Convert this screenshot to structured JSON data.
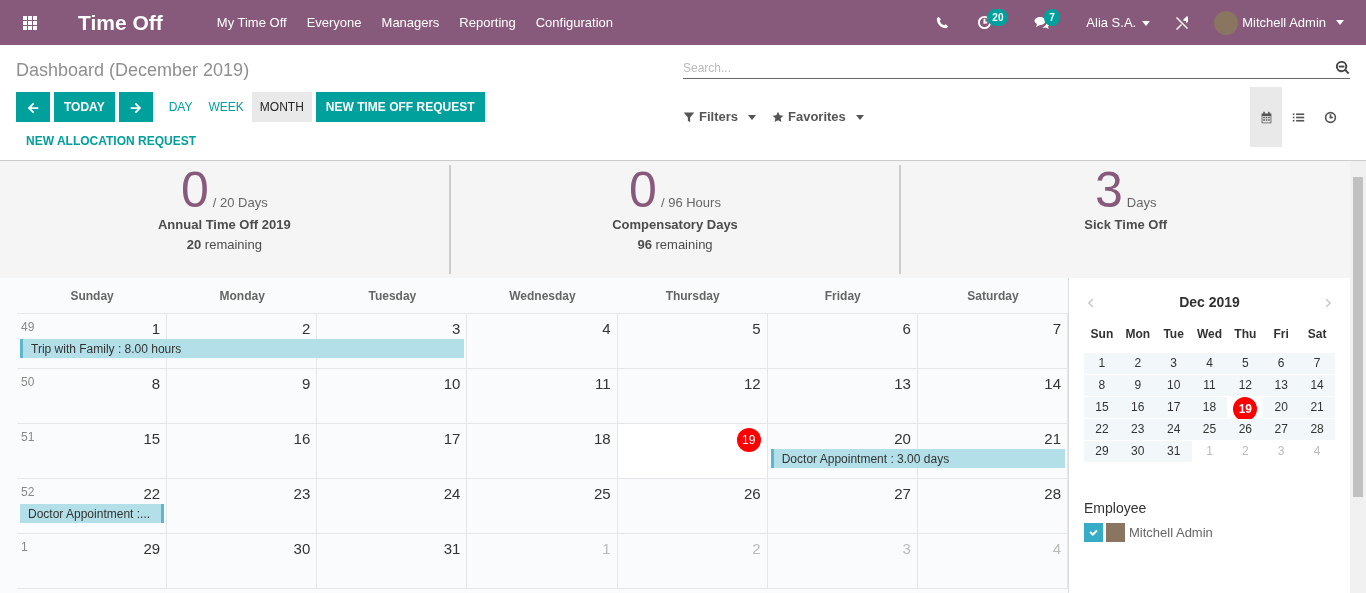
{
  "app": {
    "title": "Time Off"
  },
  "menu": [
    {
      "label": "My Time Off"
    },
    {
      "label": "Everyone"
    },
    {
      "label": "Managers"
    },
    {
      "label": "Reporting"
    },
    {
      "label": "Configuration"
    }
  ],
  "systray": {
    "activity_count": "20",
    "message_count": "7",
    "company": "Alia S.A.",
    "user": "Mitchell Admin"
  },
  "breadcrumb": "Dashboard (December 2019)",
  "today_button": "TODAY",
  "scales": [
    {
      "label": "DAY",
      "selected": false
    },
    {
      "label": "WEEK",
      "selected": false
    },
    {
      "label": "MONTH",
      "selected": true
    }
  ],
  "actions": [
    {
      "label": "NEW TIME OFF REQUEST",
      "kind": "primary"
    },
    {
      "label": "NEW ALLOCATION REQUEST",
      "kind": "link"
    }
  ],
  "search": {
    "placeholder": "Search..."
  },
  "filters": [
    {
      "label": "Filters",
      "kind": "filter"
    },
    {
      "label": "Favorites",
      "kind": "star"
    }
  ],
  "views": [
    {
      "kind": "calendar",
      "selected": true
    },
    {
      "kind": "list",
      "selected": false
    },
    {
      "kind": "activity",
      "selected": false
    }
  ],
  "summary": [
    {
      "value": "0",
      "unit": "/ 20 Days",
      "name": "Annual Time Off 2019",
      "remaining": "**20** remaining"
    },
    {
      "value": "0",
      "unit": "/ 96 Hours",
      "name": "Compensatory Days",
      "remaining": "**96** remaining"
    },
    {
      "value": "3",
      "unit": "Days",
      "name": "Sick Time Off"
    }
  ],
  "calendar": {
    "weekdays": [
      "Sunday",
      "Monday",
      "Tuesday",
      "Wednesday",
      "Thursday",
      "Friday",
      "Saturday"
    ],
    "weeks": [
      {
        "week_number": "49",
        "days": [
          {
            "day": "1",
            "event": {
              "title": "Trip with Family : 8.00 hours",
              "continued_from_previous_week": false
            }
          },
          {
            "day": "2",
            "in_event": true
          },
          {
            "day": "3",
            "in_event": true
          },
          {
            "day": "4"
          },
          {
            "day": "5"
          },
          {
            "day": "6"
          },
          {
            "day": "7"
          }
        ]
      },
      {
        "week_number": "50",
        "days": [
          {
            "day": "8"
          },
          {
            "day": "9"
          },
          {
            "day": "10"
          },
          {
            "day": "11"
          },
          {
            "day": "12"
          },
          {
            "day": "13"
          },
          {
            "day": "14"
          }
        ]
      },
      {
        "week_number": "51",
        "days": [
          {
            "day": "15"
          },
          {
            "day": "16"
          },
          {
            "day": "17"
          },
          {
            "day": "18"
          },
          {
            "day": "19",
            "today": true
          },
          {
            "day": "20",
            "event": {
              "title": "Doctor Appointment : 3.00 days",
              "continued_from_previous_week": false
            }
          },
          {
            "day": "21",
            "in_event": true
          }
        ]
      },
      {
        "week_number": "52",
        "days": [
          {
            "day": "22",
            "event": {
              "title": "Doctor Appointment :...",
              "continued_from_previous_week": true
            }
          },
          {
            "day": "23"
          },
          {
            "day": "24"
          },
          {
            "day": "25"
          },
          {
            "day": "26"
          },
          {
            "day": "27"
          },
          {
            "day": "28"
          }
        ]
      },
      {
        "week_number": "1",
        "days": [
          {
            "day": "29"
          },
          {
            "day": "30"
          },
          {
            "day": "31"
          },
          {
            "day": "1",
            "other_month": true
          },
          {
            "day": "2",
            "other_month": true
          },
          {
            "day": "3",
            "other_month": true
          },
          {
            "day": "4",
            "other_month": true
          }
        ]
      }
    ]
  },
  "mini_calendar": {
    "title": "Dec 2019",
    "weekdays": [
      "Sun",
      "Mon",
      "Tue",
      "Wed",
      "Thu",
      "Fri",
      "Sat"
    ],
    "weeks": [
      [
        {
          "day": "1"
        },
        {
          "day": "2"
        },
        {
          "day": "3"
        },
        {
          "day": "4"
        },
        {
          "day": "5"
        },
        {
          "day": "6"
        },
        {
          "day": "7"
        }
      ],
      [
        {
          "day": "8"
        },
        {
          "day": "9"
        },
        {
          "day": "10"
        },
        {
          "day": "11"
        },
        {
          "day": "12"
        },
        {
          "day": "13"
        },
        {
          "day": "14"
        }
      ],
      [
        {
          "day": "15"
        },
        {
          "day": "16"
        },
        {
          "day": "17"
        },
        {
          "day": "18"
        },
        {
          "day": "19",
          "today": true
        },
        {
          "day": "20"
        },
        {
          "day": "21"
        }
      ],
      [
        {
          "day": "22"
        },
        {
          "day": "23"
        },
        {
          "day": "24"
        },
        {
          "day": "25"
        },
        {
          "day": "26"
        },
        {
          "day": "27"
        },
        {
          "day": "28"
        }
      ],
      [
        {
          "day": "29"
        },
        {
          "day": "30"
        },
        {
          "day": "31"
        },
        {
          "day": "1",
          "other_month": true
        },
        {
          "day": "2",
          "other_month": true
        },
        {
          "day": "3",
          "other_month": true
        },
        {
          "day": "4",
          "other_month": true
        }
      ]
    ]
  },
  "employee_filter": {
    "title": "Employee",
    "items": [
      {
        "name": "Mitchell Admin",
        "checked": true
      }
    ]
  }
}
